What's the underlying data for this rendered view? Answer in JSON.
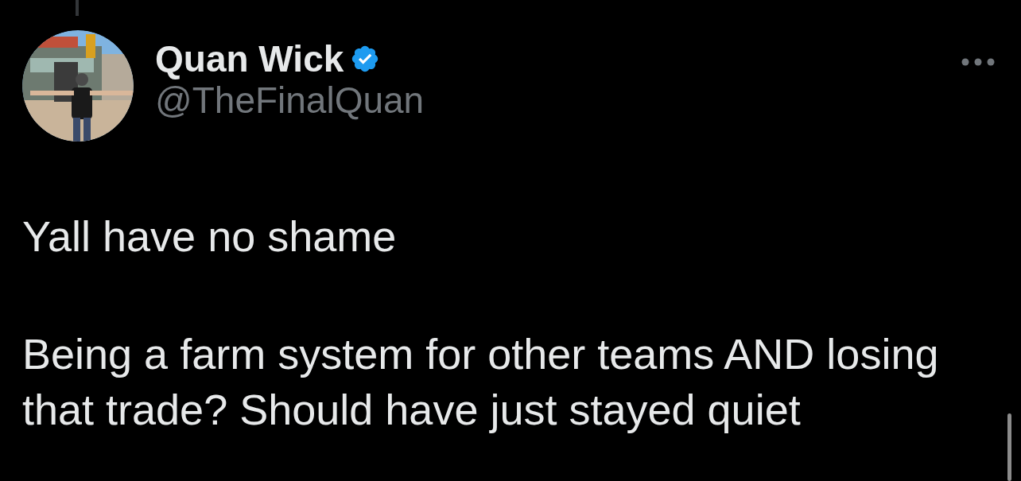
{
  "tweet": {
    "reply_thread": true,
    "author": {
      "name": "Quan Wick",
      "verified": true,
      "handle": "@TheFinalQuan"
    },
    "paragraphs": [
      "Yall have no shame",
      "Being a farm system for other teams AND losing that trade? Should have just stayed quiet"
    ]
  }
}
